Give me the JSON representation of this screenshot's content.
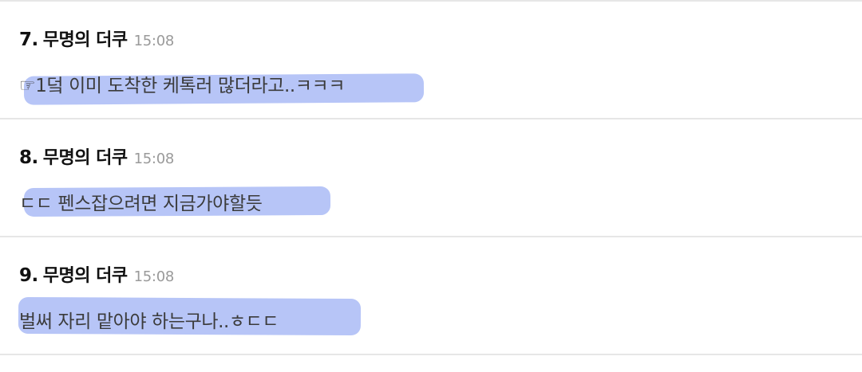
{
  "comments": [
    {
      "number": "7.",
      "author": "무명의 더쿠",
      "time": "15:08",
      "text": "☞1덬 이미 도착한 케톡러 많더라고..ㅋㅋㅋ"
    },
    {
      "number": "8.",
      "author": "무명의 더쿠",
      "time": "15:08",
      "text": "ㄷㄷ 펜스잡으려면 지금가야할듯"
    },
    {
      "number": "9.",
      "author": "무명의 더쿠",
      "time": "15:08",
      "text": "벌써 자리 맡아야 하는구나..ㅎㄷㄷ"
    }
  ],
  "colors": {
    "highlight": "#b3c2f7",
    "divider": "#e6e6e6",
    "time": "#9a9a9a"
  }
}
